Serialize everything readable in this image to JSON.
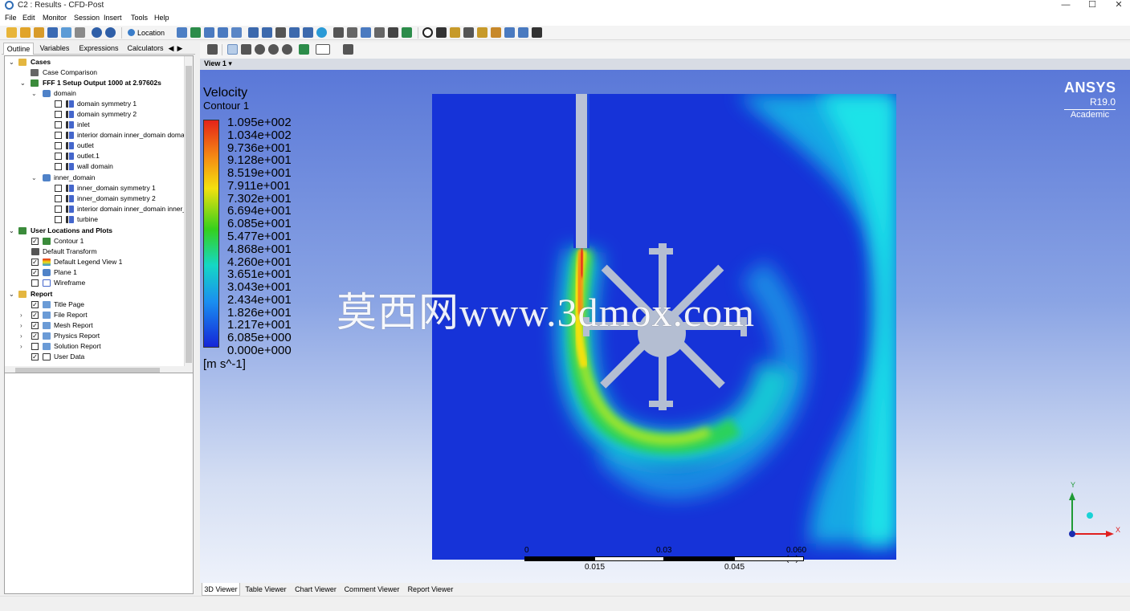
{
  "window": {
    "title": "C2 : Results - CFD-Post"
  },
  "menu": [
    "File",
    "Edit",
    "Monitor",
    "Session",
    "Insert",
    "Tools",
    "Help"
  ],
  "toolbar": {
    "location_label": "Location"
  },
  "panel_tabs": [
    "Outline",
    "Variables",
    "Expressions",
    "Calculators"
  ],
  "tree": {
    "cases": "Cases",
    "case_comparison": "Case Comparison",
    "case_name": "FFF 1 Setup Output 1000 at 2.97602s",
    "domain": "domain",
    "domain_items": [
      "domain symmetry 1",
      "domain symmetry 2",
      "inlet",
      "interior domain inner_domain domain",
      "outlet",
      "outlet.1",
      "wall domain"
    ],
    "inner_domain": "inner_domain",
    "inner_items": [
      "inner_domain symmetry 1",
      "inner_domain symmetry 2",
      "interior domain inner_domain inner_dc",
      "turbine"
    ],
    "user_locations": "User Locations and Plots",
    "user_items": [
      "Contour 1",
      "Default Transform",
      "Default Legend View 1",
      "Plane 1",
      "Wireframe"
    ],
    "report": "Report",
    "report_items": [
      "Title Page",
      "File Report",
      "Mesh Report",
      "Physics Report",
      "Solution Report",
      "User Data"
    ]
  },
  "viewer": {
    "view_label": "View 1",
    "legend": {
      "variable": "Velocity",
      "plot": "Contour 1",
      "values": [
        "1.095e+002",
        "1.034e+002",
        "9.736e+001",
        "9.128e+001",
        "8.519e+001",
        "7.911e+001",
        "7.302e+001",
        "6.694e+001",
        "6.085e+001",
        "5.477e+001",
        "4.868e+001",
        "4.260e+001",
        "3.651e+001",
        "3.043e+001",
        "2.434e+001",
        "1.826e+001",
        "1.217e+001",
        "6.085e+000",
        "0.000e+000"
      ],
      "unit": "[m s^-1]"
    },
    "logo": {
      "brand": "ANSYS",
      "version": "R19.0",
      "edition": "Academic"
    },
    "watermark": "莫西网www.3dmox.com",
    "scale": {
      "top": [
        "0",
        "0.03",
        "0.060 (m)"
      ],
      "bottom": [
        "0.015",
        "0.045"
      ]
    },
    "axes": {
      "x": "X",
      "y": "Y"
    }
  },
  "viewer_tabs": [
    "3D Viewer",
    "Table Viewer",
    "Chart Viewer",
    "Comment Viewer",
    "Report Viewer"
  ],
  "colors": {
    "accent": "#2f6db5",
    "field_low": "#1633d8",
    "field_high": "#e4231a"
  }
}
